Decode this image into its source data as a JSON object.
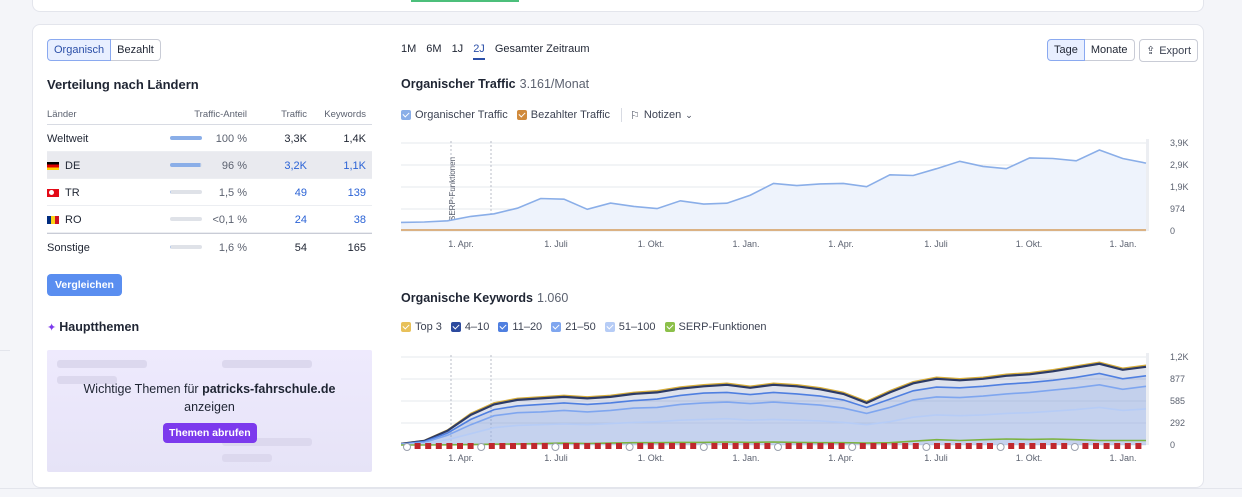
{
  "filters": {
    "organic_label": "Organisch",
    "paid_label": "Bezahlt"
  },
  "countries": {
    "title": "Verteilung nach Ländern",
    "headers": {
      "country": "Länder",
      "share": "Traffic-Anteil",
      "traffic": "Traffic",
      "keywords": "Keywords"
    },
    "rows": [
      {
        "name": "Weltweit",
        "share": "100 %",
        "share_fraction": 1.0,
        "traffic": "3,3K",
        "keywords": "1,4K"
      },
      {
        "name": "DE",
        "share": "96 %",
        "share_fraction": 0.96,
        "traffic": "3,2K",
        "keywords": "1,1K"
      },
      {
        "name": "TR",
        "share": "1,5 %",
        "share_fraction": 0.015,
        "traffic": "49",
        "keywords": "139"
      },
      {
        "name": "RO",
        "share": "<0,1 %",
        "share_fraction": 0.001,
        "traffic": "24",
        "keywords": "38"
      },
      {
        "name": "Sonstige",
        "share": "1,6 %",
        "share_fraction": 0.016,
        "traffic": "54",
        "keywords": "165"
      }
    ],
    "compare_label": "Vergleichen"
  },
  "main_topics": {
    "title": "Hauptthemen",
    "promo_text_prefix": "Wichtige Themen für",
    "promo_domain": "patricks-fahrschule.de",
    "promo_text_suffix": "anzeigen",
    "button_label": "Themen abrufen"
  },
  "toolbar": {
    "ranges": [
      "1M",
      "6M",
      "1J",
      "2J",
      "Gesamter Zeitraum"
    ],
    "active_range": "2J",
    "granularity": {
      "days": "Tage",
      "months": "Monate"
    },
    "export_label": "Export"
  },
  "traffic": {
    "title": "Organischer Traffic",
    "value": "3.161/Monat",
    "legend": {
      "organic": "Organischer Traffic",
      "paid": "Bezahlter Traffic",
      "notes": "Notizen"
    }
  },
  "keywords": {
    "title": "Organische Keywords",
    "value": "1.060",
    "legend": [
      "Top 3",
      "4–10",
      "11–20",
      "21–50",
      "51–100",
      "SERP-Funktionen"
    ]
  },
  "colors": {
    "accent": "#2b4fa8",
    "organic": "#8aaee8",
    "paid": "#d08a3c",
    "purple": "#7c3aed"
  },
  "chart_data": [
    {
      "type": "line",
      "title": "Organischer Traffic",
      "x_ticks": [
        "1. Apr.",
        "1. Juli",
        "1. Okt.",
        "1. Jan.",
        "1. Apr.",
        "1. Juli",
        "1. Okt.",
        "1. Jan."
      ],
      "y_ticks": [
        "3,9K",
        "2,9K",
        "1,9K",
        "974",
        "0"
      ],
      "ylim": [
        0,
        3900
      ],
      "annotation": "SERP-Funktionen",
      "series": [
        {
          "name": "Organischer Traffic",
          "values": [
            380,
            400,
            450,
            560,
            850,
            1100,
            1350,
            1500,
            1050,
            1150,
            1180,
            1080,
            1250,
            1280,
            1320,
            1500,
            2200,
            2100,
            2000,
            2200,
            2050,
            2400,
            2550,
            2850,
            3000,
            2950,
            2850,
            3150,
            3300,
            3200,
            3500,
            3300,
            3100
          ]
        },
        {
          "name": "Bezahlter Traffic",
          "values": [
            0,
            0,
            0,
            0,
            0,
            0,
            0,
            0,
            0,
            0,
            0,
            0,
            0,
            0,
            0,
            0,
            0,
            0,
            0,
            0,
            0,
            0,
            0,
            0,
            0,
            0,
            0,
            0,
            0,
            0,
            0,
            0,
            0
          ]
        }
      ]
    },
    {
      "type": "area",
      "title": "Organische Keywords",
      "x_ticks": [
        "1. Apr.",
        "1. Juli",
        "1. Okt.",
        "1. Jan.",
        "1. Apr.",
        "1. Juli",
        "1. Okt.",
        "1. Jan."
      ],
      "y_ticks": [
        "1,2K",
        "877",
        "585",
        "292",
        "0"
      ],
      "ylim": [
        0,
        1170
      ],
      "series": [
        {
          "name": "Top 3",
          "values": [
            20,
            60,
            200,
            420,
            560,
            620,
            640,
            660,
            640,
            660,
            700,
            720,
            770,
            800,
            820,
            780,
            820,
            800,
            760,
            700,
            580,
            720,
            840,
            900,
            880,
            900,
            940,
            960,
            1000,
            1050,
            1100,
            1020,
            1060
          ]
        },
        {
          "name": "4–10",
          "values": [
            15,
            55,
            190,
            400,
            540,
            600,
            620,
            640,
            620,
            640,
            680,
            700,
            750,
            780,
            800,
            760,
            800,
            780,
            740,
            680,
            560,
            700,
            820,
            880,
            860,
            880,
            920,
            940,
            980,
            1030,
            1080,
            1000,
            1040
          ]
        },
        {
          "name": "11–20",
          "values": [
            12,
            45,
            160,
            340,
            470,
            520,
            540,
            560,
            540,
            560,
            590,
            610,
            660,
            690,
            700,
            670,
            700,
            680,
            650,
            600,
            500,
            610,
            720,
            770,
            760,
            780,
            810,
            830,
            860,
            900,
            950,
            880,
            920
          ]
        },
        {
          "name": "21–50",
          "values": [
            10,
            35,
            130,
            270,
            390,
            430,
            440,
            460,
            440,
            460,
            490,
            500,
            540,
            560,
            570,
            550,
            570,
            550,
            530,
            490,
            420,
            500,
            600,
            640,
            630,
            650,
            680,
            700,
            730,
            760,
            800,
            740,
            780
          ]
        },
        {
          "name": "51–100",
          "values": [
            5,
            20,
            70,
            150,
            230,
            260,
            270,
            280,
            270,
            285,
            300,
            310,
            330,
            340,
            350,
            330,
            340,
            330,
            320,
            300,
            270,
            310,
            370,
            400,
            390,
            400,
            420,
            430,
            450,
            470,
            500,
            460,
            480
          ]
        },
        {
          "name": "SERP-Funktionen",
          "values": [
            0,
            0,
            2,
            5,
            10,
            15,
            20,
            25,
            20,
            25,
            30,
            30,
            35,
            35,
            40,
            35,
            40,
            35,
            30,
            30,
            25,
            30,
            50,
            70,
            60,
            70,
            80,
            75,
            80,
            70,
            60,
            60,
            60
          ]
        }
      ]
    }
  ]
}
